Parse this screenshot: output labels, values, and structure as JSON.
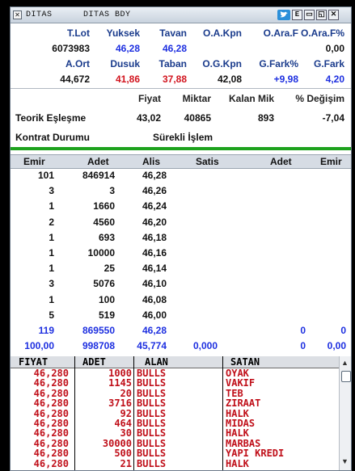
{
  "window": {
    "title_left": "DITAS",
    "title_right": "DITAS BDY",
    "btn_e": "E",
    "btn_min": "▭",
    "btn_restore": "◱",
    "btn_close": "✕",
    "close_left": "✕"
  },
  "summary": {
    "h1": {
      "tlot": "T.Lot",
      "yuksek": "Yuksek",
      "tavan": "Tavan",
      "oakpn": "O.A.Kpn",
      "oaraf": "O.Ara.F",
      "oarafp": "O.Ara.F%"
    },
    "v1": {
      "tlot": "6073983",
      "yuksek": "46,28",
      "tavan": "46,28",
      "oakpn": "",
      "oaraf": "",
      "oarafp": "0,00"
    },
    "h2": {
      "aort": "A.Ort",
      "dusuk": "Dusuk",
      "taban": "Taban",
      "ogkpn": "O.G.Kpn",
      "gfarkp": "G.Fark%",
      "gfark": "G.Fark"
    },
    "v2": {
      "aort": "44,672",
      "dusuk": "41,86",
      "taban": "37,88",
      "ogkpn": "42,08",
      "gfarkp": "+9,98",
      "gfark": "4,20"
    }
  },
  "teorik": {
    "h": {
      "fiyat": "Fiyat",
      "miktar": "Miktar",
      "kalan": "Kalan Mik",
      "degisim": "% Değişim"
    },
    "label": "Teorik Eşleşme",
    "fiyat": "43,02",
    "miktar": "40865",
    "kalan": "893",
    "degisim": "-7,04",
    "kontrat_label": "Kontrat Durumu",
    "kontrat_value": "Sürekli İşlem"
  },
  "depth": {
    "headers": {
      "emir": "Emir",
      "adet": "Adet",
      "alis": "Alis",
      "satis": "Satis",
      "adet2": "Adet",
      "emir2": "Emir"
    },
    "rows": [
      {
        "emir": "101",
        "adet": "846914",
        "alis": "46,28"
      },
      {
        "emir": "3",
        "adet": "3",
        "alis": "46,26"
      },
      {
        "emir": "1",
        "adet": "1660",
        "alis": "46,24"
      },
      {
        "emir": "2",
        "adet": "4560",
        "alis": "46,20"
      },
      {
        "emir": "1",
        "adet": "693",
        "alis": "46,18"
      },
      {
        "emir": "1",
        "adet": "10000",
        "alis": "46,16"
      },
      {
        "emir": "1",
        "adet": "25",
        "alis": "46,14"
      },
      {
        "emir": "3",
        "adet": "5076",
        "alis": "46,10"
      },
      {
        "emir": "1",
        "adet": "100",
        "alis": "46,08"
      },
      {
        "emir": "5",
        "adet": "519",
        "alis": "46,00"
      }
    ],
    "total1": {
      "emir": "119",
      "adet": "869550",
      "alis": "46,28",
      "satis": "",
      "adet2": "0",
      "emir2": "0"
    },
    "total2": {
      "emir": "100,00",
      "adet": "998708",
      "alis": "45,774",
      "satis": "0,000",
      "adet2": "0",
      "emir2": "0,00"
    }
  },
  "trades": {
    "headers": {
      "fiyat": "FIYAT",
      "adet": "ADET",
      "alan": "ALAN",
      "satan": "SATAN"
    },
    "rows": [
      {
        "fiyat": "46,280",
        "adet": "1000",
        "alan": "BULLS",
        "satan": "OYAK"
      },
      {
        "fiyat": "46,280",
        "adet": "1145",
        "alan": "BULLS",
        "satan": "VAKIF"
      },
      {
        "fiyat": "46,280",
        "adet": "20",
        "alan": "BULLS",
        "satan": "TEB"
      },
      {
        "fiyat": "46,280",
        "adet": "3716",
        "alan": "BULLS",
        "satan": "ZIRAAT"
      },
      {
        "fiyat": "46,280",
        "adet": "92",
        "alan": "BULLS",
        "satan": "HALK"
      },
      {
        "fiyat": "46,280",
        "adet": "464",
        "alan": "BULLS",
        "satan": "MIDAS"
      },
      {
        "fiyat": "46,280",
        "adet": "30",
        "alan": "BULLS",
        "satan": "HALK"
      },
      {
        "fiyat": "46,280",
        "adet": "30000",
        "alan": "BULLS",
        "satan": "MARBAS"
      },
      {
        "fiyat": "46,280",
        "adet": "500",
        "alan": "BULLS",
        "satan": "YAPI KREDI"
      },
      {
        "fiyat": "46,280",
        "adet": "21",
        "alan": "BULLS",
        "satan": "HALK"
      }
    ]
  },
  "colors": {
    "header": "#1a3b8c",
    "blue": "#1d2fe0",
    "red": "#d2141e",
    "green_bar": "#1da21d",
    "trade_red": "#c0101a"
  }
}
